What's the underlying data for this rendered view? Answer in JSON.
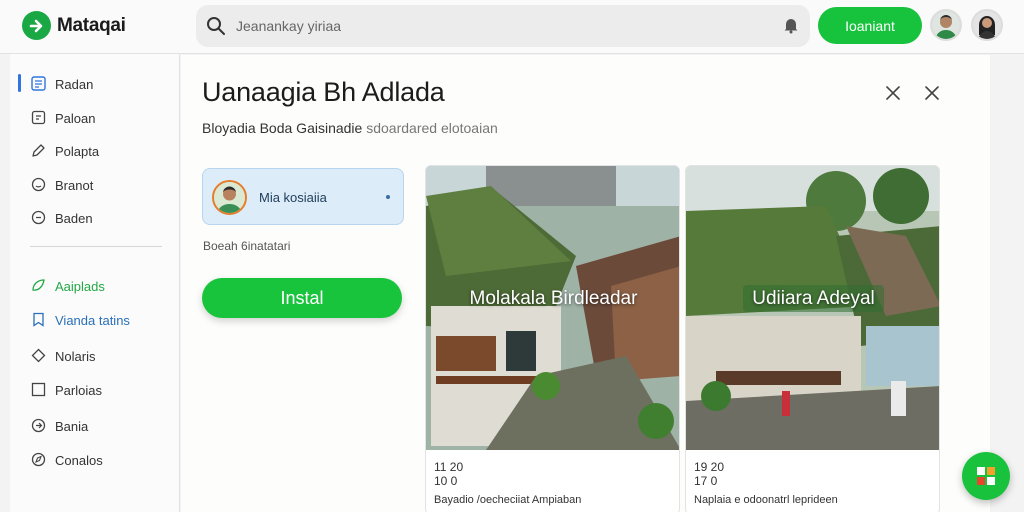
{
  "app": {
    "name": "Mataqai"
  },
  "search": {
    "placeholder": "Jeanankay yiriaa"
  },
  "header": {
    "primary_button": "Ioaniant"
  },
  "sidebar": {
    "items": [
      {
        "label": "Radan"
      },
      {
        "label": "Paloan"
      },
      {
        "label": "Polapta"
      },
      {
        "label": "Branot"
      },
      {
        "label": "Baden"
      },
      {
        "label": "Aaiplads"
      },
      {
        "label": "Vianda tatins"
      },
      {
        "label": "Nolaris"
      },
      {
        "label": "Parloias"
      },
      {
        "label": "Bania"
      },
      {
        "label": "Conalos"
      }
    ]
  },
  "main": {
    "title": "Uanaagia Bh Adlada",
    "subtitle": "Bloyadia Boda Gaisinadie",
    "subtitle_muted": "sdoardared elotoaian",
    "profile": {
      "name": "Mia kosiaiia",
      "meta": "Boeah 6inatatari"
    },
    "install_button": "Instal"
  },
  "cards": [
    {
      "overlay": "Molakala Birdleadar",
      "meta_line1": "11 20",
      "meta_line2": "10 0",
      "caption": "Bayadio /oecheciiat Ampiaban"
    },
    {
      "overlay": "Udiiara Adeyal",
      "meta_line1": "19 20",
      "meta_line2": "17 0",
      "caption": "Naplaia e odoonatrl leprideen"
    }
  ],
  "colors": {
    "accent_green": "#18c23c",
    "accent_blue": "#2f74e0"
  },
  "icons": [
    "search-icon",
    "bell-icon",
    "close-icon",
    "fab-icon"
  ]
}
